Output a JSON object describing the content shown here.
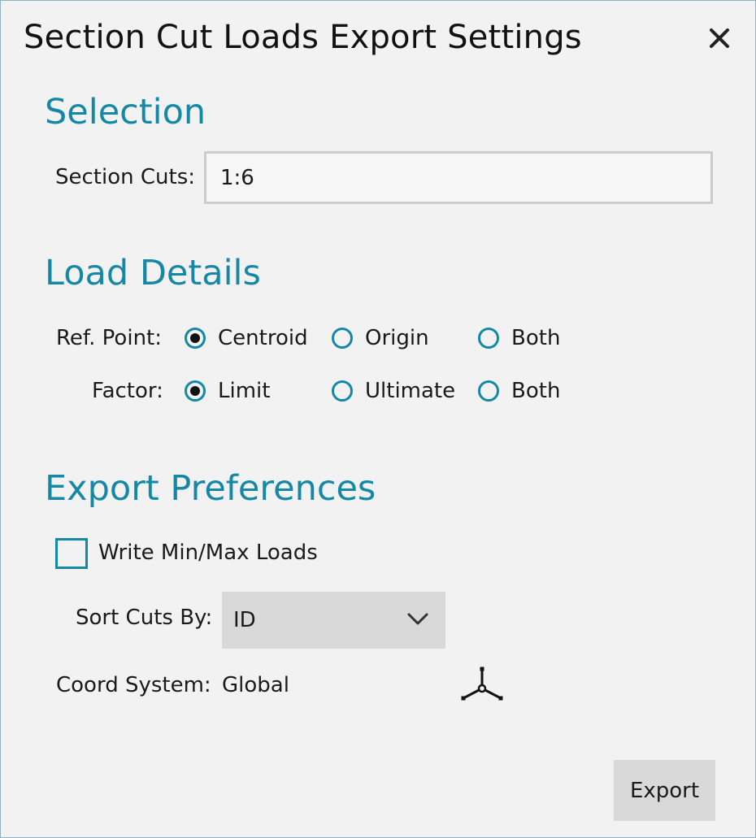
{
  "dialog": {
    "title": "Section Cut Loads Export Settings",
    "close_icon": "close-icon"
  },
  "selection": {
    "heading": "Selection",
    "section_cuts_label": "Section Cuts:",
    "section_cuts_value": "1:6"
  },
  "load_details": {
    "heading": "Load Details",
    "ref_point": {
      "label": "Ref. Point:",
      "options": [
        "Centroid",
        "Origin",
        "Both"
      ],
      "selected": "Centroid"
    },
    "factor": {
      "label": "Factor:",
      "options": [
        "Limit",
        "Ultimate",
        "Both"
      ],
      "selected": "Limit"
    }
  },
  "export_preferences": {
    "heading": "Export Preferences",
    "write_minmax_label": "Write Min/Max Loads",
    "write_minmax_checked": false,
    "sort_cuts_label": "Sort Cuts By:",
    "sort_cuts_value": "ID",
    "coord_system_label": "Coord System:",
    "coord_system_value": "Global",
    "coord_icon": "coordinate-axes-icon"
  },
  "actions": {
    "export_label": "Export"
  },
  "colors": {
    "accent": "#1588a6",
    "background": "#f2f2f2",
    "button": "#d9d9d9"
  }
}
